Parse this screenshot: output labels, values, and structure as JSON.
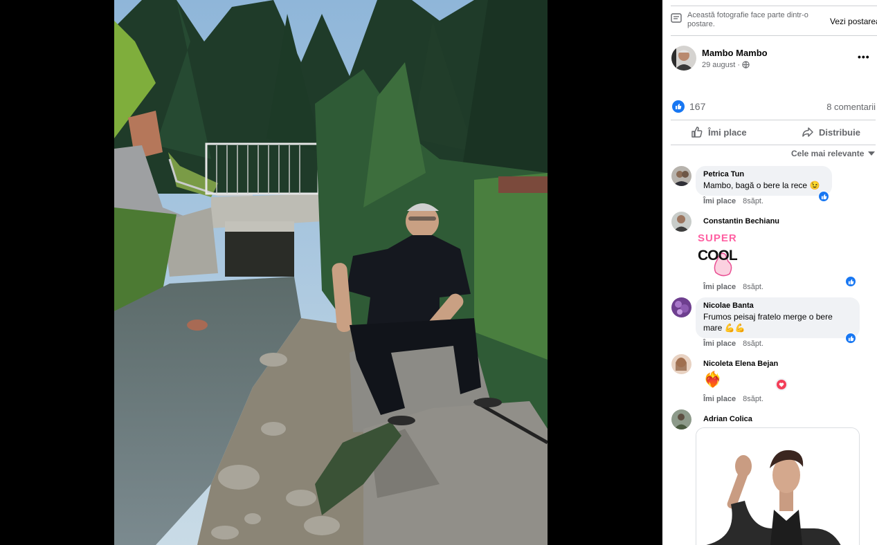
{
  "post_notice": {
    "text": "Această fotografie face parte dintr-o postare.",
    "link": "Vezi postarea"
  },
  "author": {
    "name": "Mambo Mambo",
    "date": "29 august",
    "separator": "·",
    "more": "•••"
  },
  "stats": {
    "likes": "167",
    "comments": "8 comentarii"
  },
  "actions": {
    "like": "Îmi place",
    "share": "Distribuie"
  },
  "sort": {
    "label": "Cele mai relevante"
  },
  "comments": [
    {
      "name": "Petrica Tun",
      "text": "Mambo, bagă o bere la rece",
      "emoji": "😉",
      "like": "Îmi place",
      "time": "8săpt."
    },
    {
      "name": "Constantin Bechianu",
      "sticker_lines": [
        "SUPER",
        "COOL"
      ],
      "like": "Îmi place",
      "time": "8săpt."
    },
    {
      "name": "Nicolae Banta",
      "text": "Frumos peisaj fratelo merge o bere mare",
      "emoji": "💪💪",
      "like": "Îmi place",
      "time": "8săpt."
    },
    {
      "name": "Nicoleta Elena Bejan",
      "emoji": "❤️‍🔥",
      "like": "Îmi place",
      "time": "8săpt."
    },
    {
      "name": "Adrian Colica"
    }
  ],
  "colors": {
    "accent": "#1877f2",
    "secondary_text": "#65676b",
    "bubble": "#f0f2f5",
    "heart": "#f33e58"
  }
}
